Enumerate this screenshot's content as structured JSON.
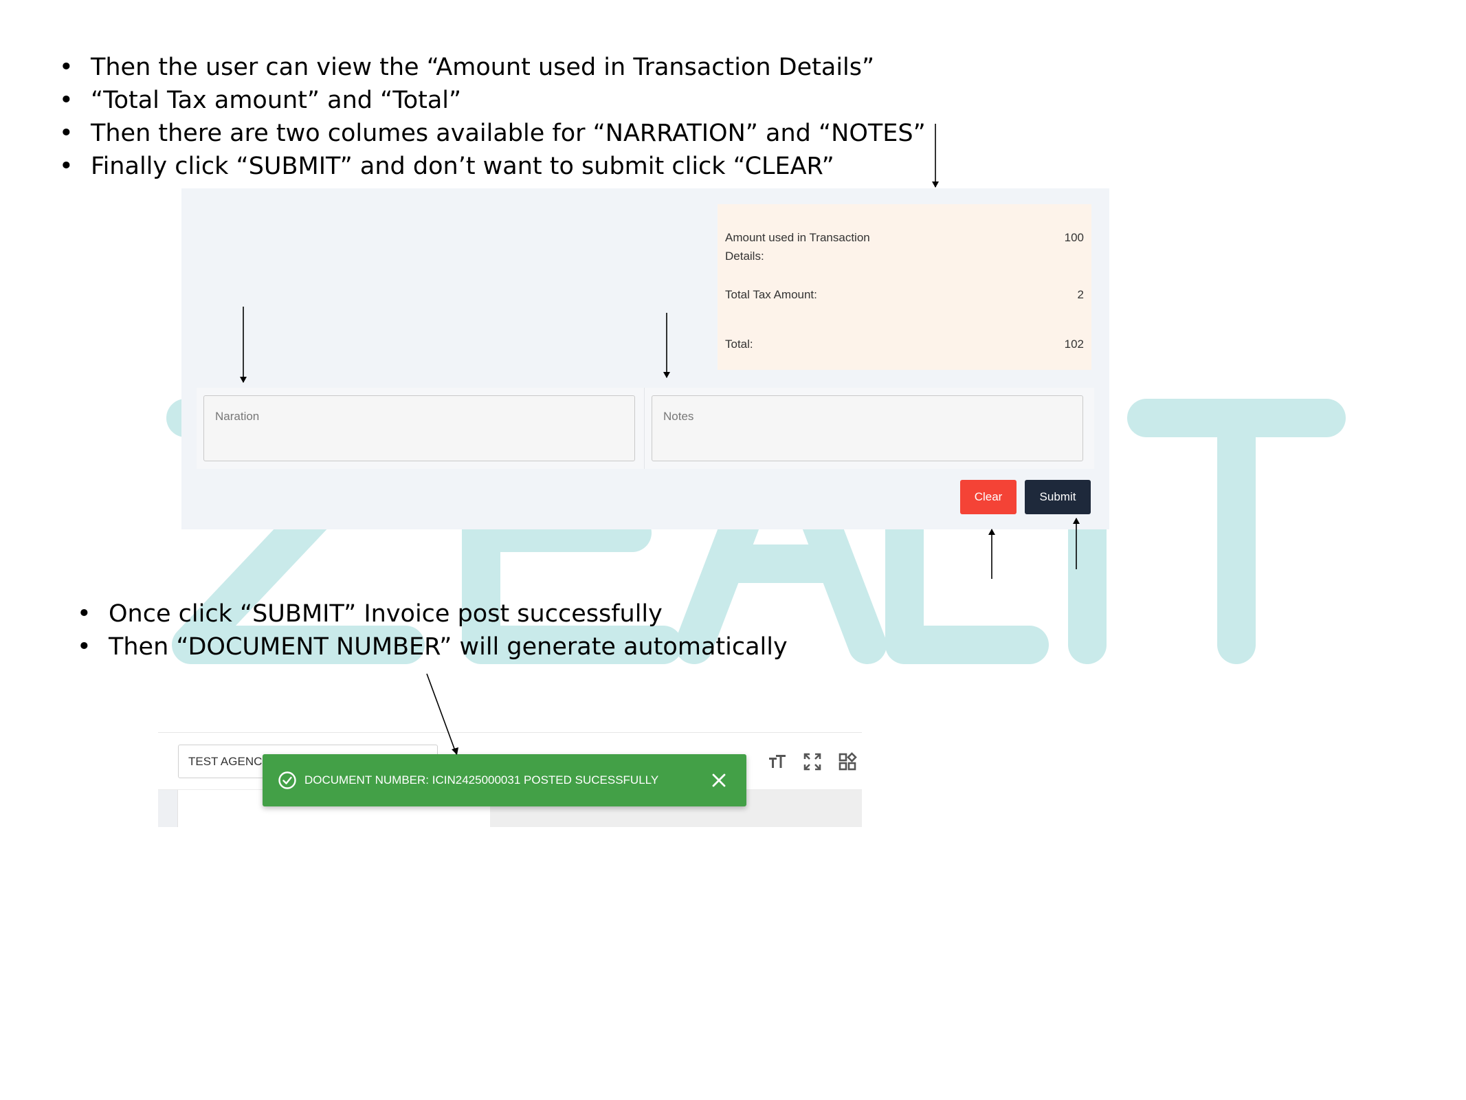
{
  "instructions_top": [
    "Then the user can view  the “Amount used in Transaction Details”",
    "“Total Tax amount” and “Total”",
    "Then there are two columes available for “NARRATION” and “NOTES”",
    "Finally click “SUBMIT” and don’t want to submit click “CLEAR”"
  ],
  "instructions_bottom": [
    "Once  click “SUBMIT” Invoice post successfully",
    "Then “DOCUMENT NUMBER” will generate automatically"
  ],
  "totals": {
    "amount_label": "Amount used in Transaction Details:",
    "amount_value": "100",
    "tax_label": "Total Tax Amount:",
    "tax_value": "2",
    "total_label": "Total:",
    "total_value": "102"
  },
  "fields": {
    "narration_placeholder": "Naration",
    "notes_placeholder": "Notes"
  },
  "buttons": {
    "clear_label": "Clear",
    "submit_label": "Submit"
  },
  "toolbar": {
    "agency_value": "TEST AGENCY"
  },
  "toast": {
    "message": "DOCUMENT NUMBER: ICIN2425000031 POSTED SUCESSFULLY"
  },
  "colors": {
    "watermark": "#c9eaea",
    "clear_button": "#f44336",
    "submit_button": "#1e293b",
    "toast_bg": "#43a047",
    "totals_bg": "#fdf3ea",
    "panel_bg": "#f1f4f8"
  }
}
